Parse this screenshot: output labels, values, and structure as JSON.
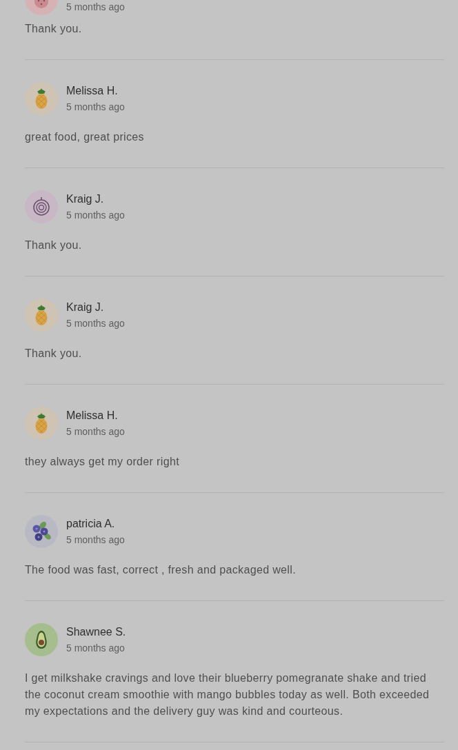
{
  "reviews": [
    {
      "avatar": {
        "kind": "berry"
      },
      "time": "5 months ago",
      "text": "Thank you."
    },
    {
      "avatar": {
        "kind": "pineapple"
      },
      "name": "Melissa H.",
      "time": "5 months ago",
      "text": "great food, great prices"
    },
    {
      "avatar": {
        "kind": "onion"
      },
      "name": "Kraig J.",
      "time": "5 months ago",
      "text": "Thank you."
    },
    {
      "avatar": {
        "kind": "pineapple"
      },
      "name": "Kraig J.",
      "time": "5 months ago",
      "text": "Thank you."
    },
    {
      "avatar": {
        "kind": "pineapple"
      },
      "name": "Melissa H.",
      "time": "5 months ago",
      "text": "they always get my order right"
    },
    {
      "avatar": {
        "kind": "blueberries"
      },
      "name": "patricia A.",
      "time": "5 months ago",
      "text": "The food was fast, correct , fresh and packaged well."
    },
    {
      "avatar": {
        "kind": "avocado"
      },
      "name": "Shawnee S.",
      "time": "5 months ago",
      "text": "I get milkshake cravings and love their blueberry pomegranate shake and tried the coconut cream smoothie with mango bubbles today as well. Both exceeded my expectations and the delivery guy was kind and courteous."
    }
  ]
}
